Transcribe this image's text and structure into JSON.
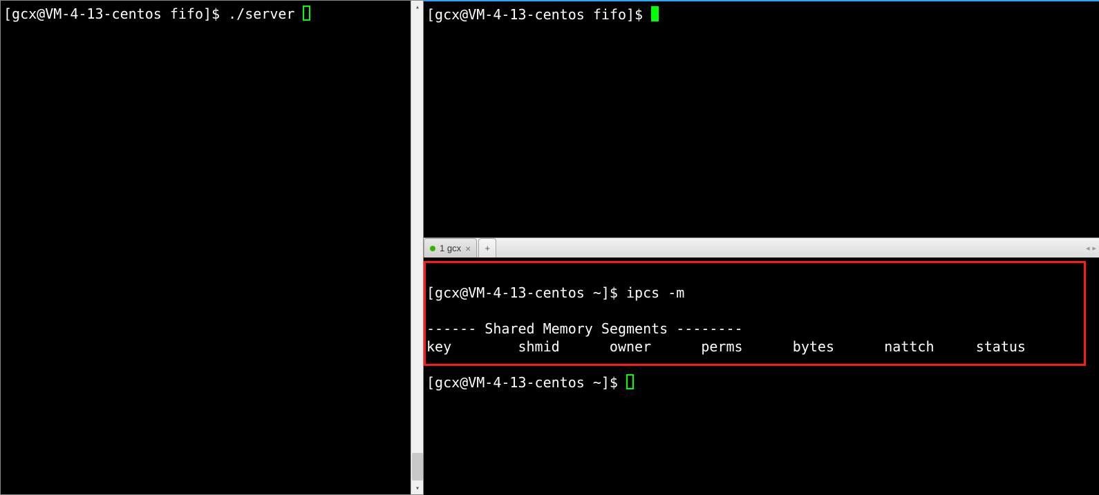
{
  "left": {
    "prompt": "[gcx@VM-4-13-centos fifo]$ ",
    "command": "./server "
  },
  "rightTop": {
    "prompt": "[gcx@VM-4-13-centos fifo]$ "
  },
  "tab": {
    "label": "1 gcx"
  },
  "rightBottom": {
    "prompt1": "[gcx@VM-4-13-centos ~]$ ",
    "command1": "ipcs -m",
    "blank": "",
    "header": "------ Shared Memory Segments --------",
    "cols": "key        shmid      owner      perms      bytes      nattch     status",
    "prompt2": "[gcx@VM-4-13-centos ~]$ "
  }
}
